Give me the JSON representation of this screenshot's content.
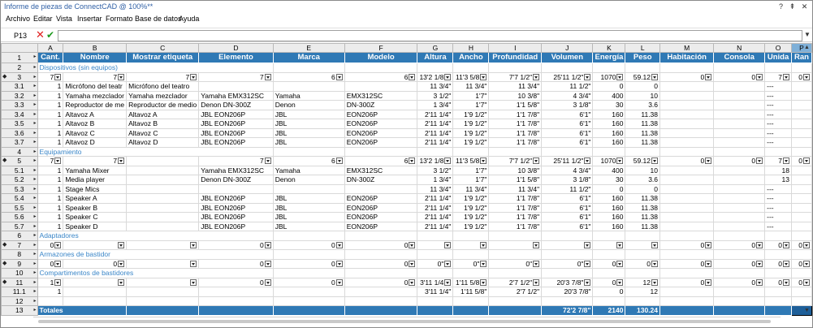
{
  "window": {
    "title": "Informe de piezas de ConnectCAD @ 100%**",
    "help_label": "?",
    "pin_label": "⇞",
    "close_label": "✕"
  },
  "menu": [
    "Archivo",
    "Editar",
    "Vista",
    "Insertar",
    "Formato",
    "Base de datos",
    "Ayuda"
  ],
  "formula_bar": {
    "cell_ref": "P13",
    "cancel_icon": "x-icon",
    "accept_icon": "check-icon",
    "value": ""
  },
  "columns": {
    "letters": [
      "A",
      "B",
      "C",
      "D",
      "E",
      "F",
      "G",
      "H",
      "I",
      "J",
      "K",
      "L",
      "M",
      "N",
      "O",
      "P"
    ],
    "headers": [
      "Cant.",
      "Nombre",
      "Mostrar etiqueta",
      "Elemento",
      "Marca",
      "Modelo",
      "Altura",
      "Ancho",
      "Profundidad",
      "Volumen",
      "Energía",
      "Peso",
      "Habitación",
      "Consola",
      "Unida",
      "Ran"
    ]
  },
  "rows": [
    {
      "id": "1",
      "type": "header"
    },
    {
      "id": "2",
      "type": "section",
      "label": "Dispositivos (sin equipos)"
    },
    {
      "id": "3",
      "type": "summary",
      "cells": [
        "7",
        "7",
        "7",
        "7",
        "6",
        "6",
        "13'2 1/8",
        "11'3 5/8",
        "7'7 1/2\"",
        "25'11 1/2\"",
        "1070",
        "59.12",
        "0",
        "0",
        "7",
        "0"
      ],
      "dd": [
        1,
        1,
        1,
        1,
        1,
        1,
        1,
        1,
        1,
        1,
        1,
        1,
        1,
        1,
        1,
        1
      ]
    },
    {
      "id": "3.1",
      "type": "data",
      "cells": [
        "1",
        "Micrófono del teatr",
        "Micrófono del teatro",
        "",
        "",
        "",
        "11 3/4\"",
        "11 3/4\"",
        "11 3/4\"",
        "11 1/2\"",
        "0",
        "0",
        "",
        "",
        "---",
        ""
      ]
    },
    {
      "id": "3.2",
      "type": "data",
      "cells": [
        "1",
        "Yamaha mezclador",
        "Yamaha mezclador",
        "Yamaha EMX312SC",
        "Yamaha",
        "EMX312SC",
        "3 1/2\"",
        "1'7\"",
        "10 3/8\"",
        "4 3/4\"",
        "400",
        "10",
        "",
        "",
        "---",
        ""
      ]
    },
    {
      "id": "3.3",
      "type": "data",
      "cells": [
        "1",
        "Reproductor de me",
        "Reproductor de medio",
        "Denon DN-300Z",
        "Denon",
        "DN-300Z",
        "1 3/4\"",
        "1'7\"",
        "1'1 5/8\"",
        "3 1/8\"",
        "30",
        "3.6",
        "",
        "",
        "---",
        ""
      ]
    },
    {
      "id": "3.4",
      "type": "data",
      "cells": [
        "1",
        "Altavoz A",
        "Altavoz A",
        "JBL EON206P",
        "JBL",
        "EON206P",
        "2'11 1/4\"",
        "1'9 1/2\"",
        "1'1 7/8\"",
        "6'1\"",
        "160",
        "11.38",
        "",
        "",
        "---",
        ""
      ]
    },
    {
      "id": "3.5",
      "type": "data",
      "cells": [
        "1",
        "Altavoz B",
        "Altavoz B",
        "JBL EON206P",
        "JBL",
        "EON206P",
        "2'11 1/4\"",
        "1'9 1/2\"",
        "1'1 7/8\"",
        "6'1\"",
        "160",
        "11.38",
        "",
        "",
        "---",
        ""
      ]
    },
    {
      "id": "3.6",
      "type": "data",
      "cells": [
        "1",
        "Altavoz C",
        "Altavoz C",
        "JBL EON206P",
        "JBL",
        "EON206P",
        "2'11 1/4\"",
        "1'9 1/2\"",
        "1'1 7/8\"",
        "6'1\"",
        "160",
        "11.38",
        "",
        "",
        "---",
        ""
      ]
    },
    {
      "id": "3.7",
      "type": "data",
      "cells": [
        "1",
        "Altavoz D",
        "Altavoz D",
        "JBL EON206P",
        "JBL",
        "EON206P",
        "2'11 1/4\"",
        "1'9 1/2\"",
        "1'1 7/8\"",
        "6'1\"",
        "160",
        "11.38",
        "",
        "",
        "---",
        ""
      ]
    },
    {
      "id": "4",
      "type": "section",
      "label": "Equipamiento"
    },
    {
      "id": "5",
      "type": "summary",
      "cells": [
        "7",
        "7",
        "",
        "7",
        "6",
        "6",
        "13'2 1/8",
        "11'3 5/8",
        "7'7 1/2\"",
        "25'11 1/2\"",
        "1070",
        "59.12",
        "0",
        "0",
        "7",
        "0"
      ],
      "dd": [
        1,
        1,
        0,
        1,
        1,
        1,
        1,
        1,
        1,
        1,
        1,
        1,
        1,
        1,
        1,
        1
      ]
    },
    {
      "id": "5.1",
      "type": "data",
      "cells": [
        "1",
        "Yamaha Mixer",
        "",
        "Yamaha EMX312SC",
        "Yamaha",
        "EMX312SC",
        "3 1/2\"",
        "1'7\"",
        "10 3/8\"",
        "4 3/4\"",
        "400",
        "10",
        "",
        "",
        "18",
        ""
      ]
    },
    {
      "id": "5.2",
      "type": "data",
      "cells": [
        "1",
        "Media player",
        "",
        "Denon DN-300Z",
        "Denon",
        "DN-300Z",
        "1 3/4\"",
        "1'7\"",
        "1'1 5/8\"",
        "3 1/8\"",
        "30",
        "3.6",
        "",
        "",
        "13",
        ""
      ]
    },
    {
      "id": "5.3",
      "type": "data",
      "cells": [
        "1",
        "Stage Mics",
        "",
        "",
        "",
        "",
        "11 3/4\"",
        "11 3/4\"",
        "11 3/4\"",
        "11 1/2\"",
        "0",
        "0",
        "",
        "",
        "---",
        ""
      ]
    },
    {
      "id": "5.4",
      "type": "data",
      "cells": [
        "1",
        "Speaker A",
        "",
        "JBL EON206P",
        "JBL",
        "EON206P",
        "2'11 1/4\"",
        "1'9 1/2\"",
        "1'1 7/8\"",
        "6'1\"",
        "160",
        "11.38",
        "",
        "",
        "---",
        ""
      ]
    },
    {
      "id": "5.5",
      "type": "data",
      "cells": [
        "1",
        "Speaker B",
        "",
        "JBL EON206P",
        "JBL",
        "EON206P",
        "2'11 1/4\"",
        "1'9 1/2\"",
        "1'1 7/8\"",
        "6'1\"",
        "160",
        "11.38",
        "",
        "",
        "---",
        ""
      ]
    },
    {
      "id": "5.6",
      "type": "data",
      "cells": [
        "1",
        "Speaker C",
        "",
        "JBL EON206P",
        "JBL",
        "EON206P",
        "2'11 1/4\"",
        "1'9 1/2\"",
        "1'1 7/8\"",
        "6'1\"",
        "160",
        "11.38",
        "",
        "",
        "---",
        ""
      ]
    },
    {
      "id": "5.7",
      "type": "data",
      "cells": [
        "1",
        "Speaker D",
        "",
        "JBL EON206P",
        "JBL",
        "EON206P",
        "2'11 1/4\"",
        "1'9 1/2\"",
        "1'1 7/8\"",
        "6'1\"",
        "160",
        "11.38",
        "",
        "",
        "---",
        ""
      ]
    },
    {
      "id": "6",
      "type": "section",
      "label": "Adaptadores"
    },
    {
      "id": "7",
      "type": "summary",
      "cells": [
        "0",
        "",
        "",
        "0",
        "0",
        "0",
        "",
        "",
        "",
        "",
        "",
        "",
        "0",
        "0",
        "0",
        "0"
      ],
      "dd": [
        1,
        1,
        1,
        1,
        1,
        1,
        1,
        1,
        1,
        1,
        1,
        1,
        1,
        1,
        1,
        1
      ]
    },
    {
      "id": "8",
      "type": "section",
      "label": "Armazones de bastidor"
    },
    {
      "id": "9",
      "type": "summary",
      "cells": [
        "0",
        "0",
        "",
        "0",
        "0",
        "0",
        "0\"",
        "0\"",
        "0\"",
        "0\"",
        "0",
        "0",
        "0",
        "0",
        "0",
        "0"
      ],
      "dd": [
        1,
        1,
        1,
        1,
        1,
        1,
        1,
        1,
        1,
        1,
        1,
        1,
        1,
        1,
        1,
        1
      ]
    },
    {
      "id": "10",
      "type": "section",
      "label": "Compartimentos de bastidores"
    },
    {
      "id": "11",
      "type": "summary",
      "cells": [
        "1",
        "",
        "",
        "0",
        "0",
        "0",
        "3'11 1/4",
        "1'11 5/8",
        "2'7 1/2\"",
        "20'3 7/8\"",
        "0",
        "12",
        "0",
        "0",
        "0",
        "0"
      ],
      "dd": [
        1,
        1,
        1,
        1,
        1,
        1,
        1,
        1,
        1,
        1,
        1,
        1,
        1,
        1,
        1,
        1
      ]
    },
    {
      "id": "11.1",
      "type": "data",
      "cells": [
        "1",
        "",
        "",
        "",
        "",
        "",
        "3'11 1/4\"",
        "1'11 5/8\"",
        "2'7 1/2\"",
        "20'3 7/8\"",
        "0",
        "12",
        "",
        "",
        "",
        ""
      ]
    },
    {
      "id": "12",
      "type": "blank"
    },
    {
      "id": "13",
      "type": "total",
      "label": "Totales",
      "cells": [
        "",
        "",
        "",
        "",
        "",
        "",
        "",
        "",
        "",
        "72'2 7/8\"",
        "2140",
        "130.24",
        "",
        "",
        "",
        ""
      ]
    }
  ],
  "colors": {
    "header_bg": "#2f79b5",
    "section_text": "#3a86c8",
    "cancel": "#e02020",
    "accept": "#1e9a1e"
  }
}
